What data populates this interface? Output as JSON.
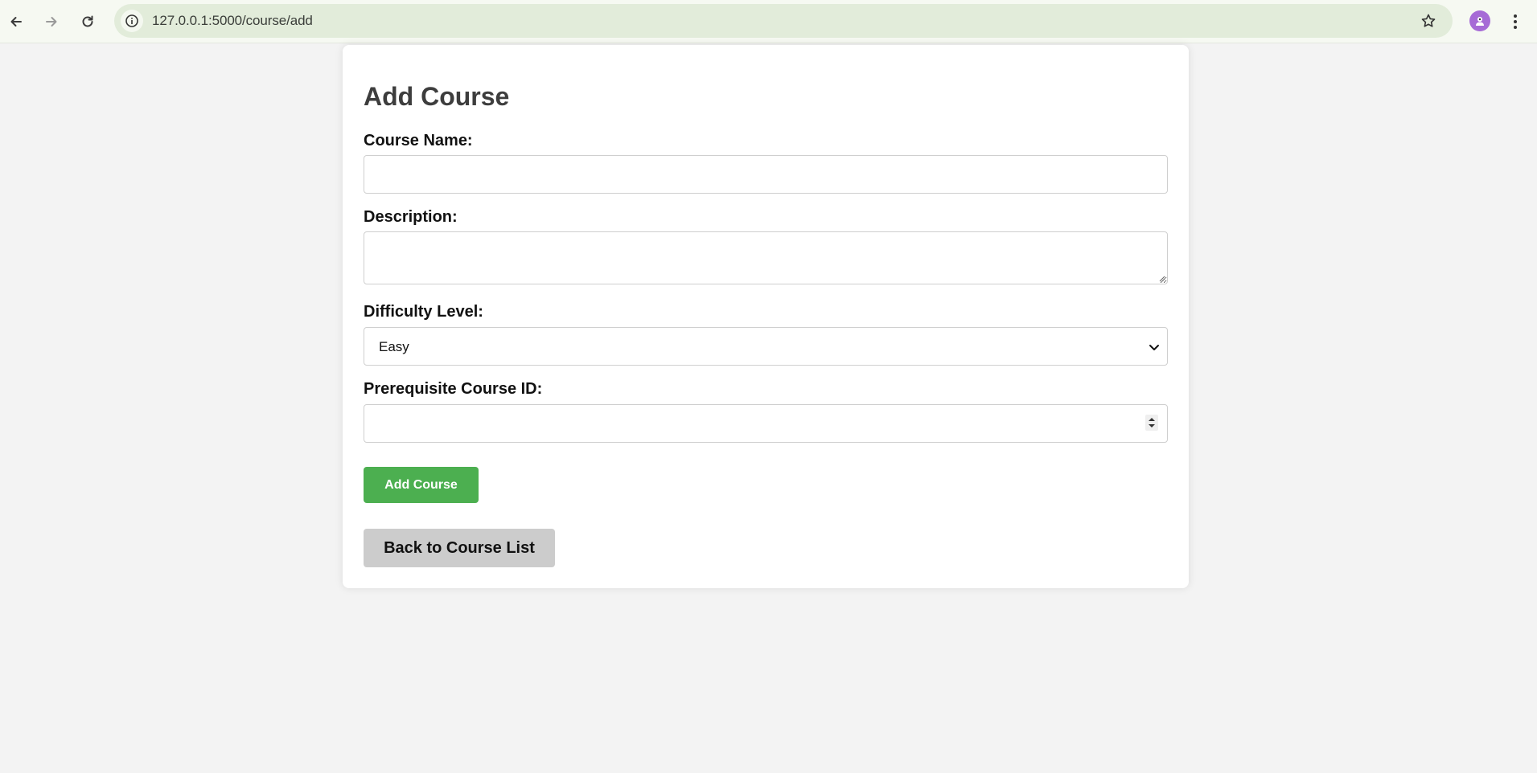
{
  "browser": {
    "url": "127.0.0.1:5000/course/add",
    "icons": {
      "back": "back-arrow-icon",
      "forward": "forward-arrow-icon",
      "reload": "reload-icon",
      "site_info": "info-icon",
      "bookmark": "star-icon",
      "profile": "profile-avatar-icon",
      "menu": "kebab-menu-icon"
    }
  },
  "form": {
    "title": "Add Course",
    "course_name": {
      "label": "Course Name:",
      "value": ""
    },
    "description": {
      "label": "Description:",
      "value": ""
    },
    "difficulty": {
      "label": "Difficulty Level:",
      "selected": "Easy"
    },
    "prerequisite": {
      "label": "Prerequisite Course ID:",
      "value": ""
    },
    "submit_label": "Add Course",
    "back_label": "Back to Course List"
  },
  "colors": {
    "page_bg": "#f3f3f3",
    "card_bg": "#ffffff",
    "primary_button": "#4caf50",
    "secondary_button": "#cccccc",
    "omnibox": "#e2ecda",
    "avatar": "#a66bd6"
  }
}
